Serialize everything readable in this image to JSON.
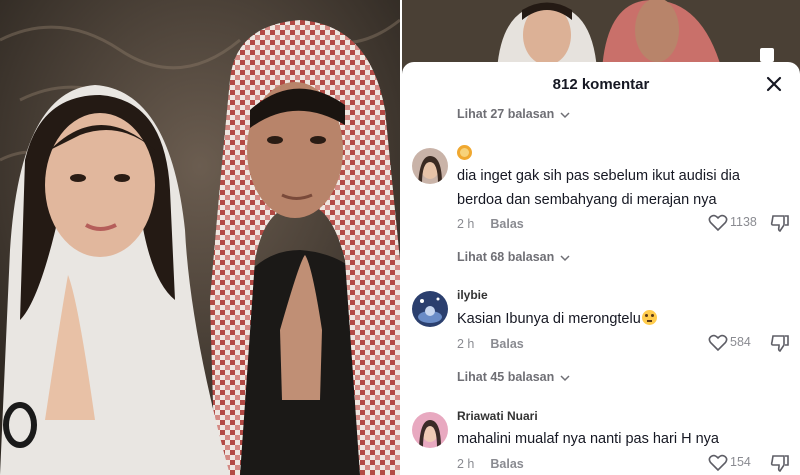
{
  "header": {
    "title": "812 komentar",
    "close_icon": "close-icon"
  },
  "comments": [
    {
      "replies_above": "Lihat 27 balasan",
      "username": "",
      "username_emoji": "lion-emoji",
      "text": "dia inget gak sih pas sebelum ikut audisi dia berdoa dan sembahyang di merajan nya",
      "time": "2 h",
      "reply_label": "Balas",
      "likes": "1138"
    },
    {
      "replies_above": "Lihat 68 balasan",
      "username": "ilybie",
      "text": "Kasian Ibunya di merongtelu",
      "text_emoji": "flushed-face-emoji",
      "time": "2 h",
      "reply_label": "Balas",
      "likes": "584"
    },
    {
      "replies_above": "Lihat 45 balasan",
      "username": "Rriawati Nuari",
      "text": "mahalini mualaf nya nanti pas hari H nya",
      "time": "2 h",
      "reply_label": "Balas",
      "likes": "154"
    }
  ],
  "colors": {
    "sheet_bg": "#ffffff",
    "text_primary": "#161823",
    "text_secondary": "#8a8b91"
  }
}
